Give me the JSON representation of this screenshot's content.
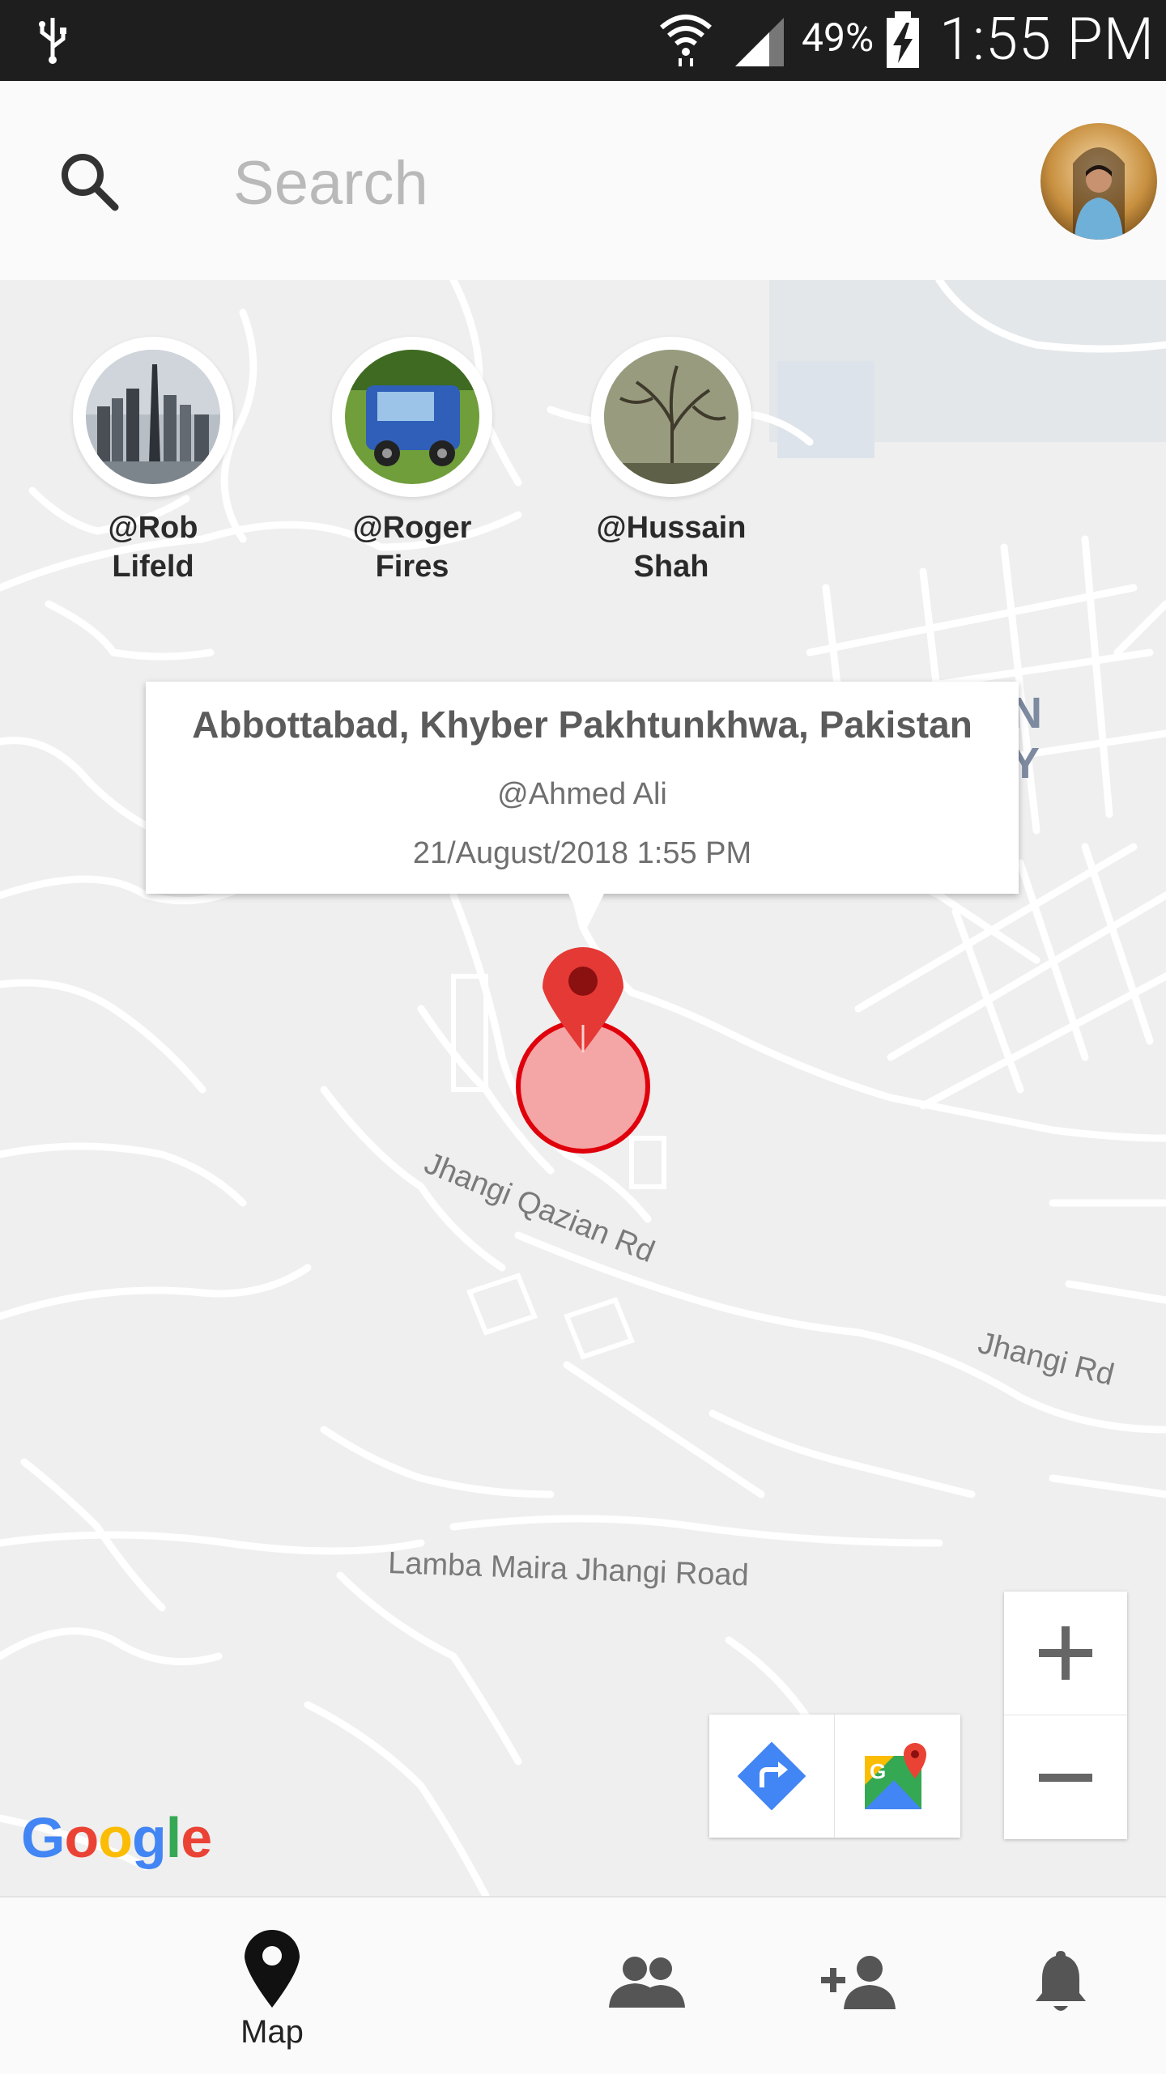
{
  "status_bar": {
    "battery": "49%",
    "time": "1:55 PM"
  },
  "search": {
    "placeholder": "Search"
  },
  "friends": [
    {
      "handle": "@Rob Lifeld"
    },
    {
      "handle": "@Roger Fires"
    },
    {
      "handle": "@Hussain Shah"
    }
  ],
  "info_window": {
    "place": "Abbottabad, Khyber Pakhtunkhwa, Pakistan",
    "user": "@Ahmed Ali",
    "timestamp": "21/August/2018  1:55 PM"
  },
  "map": {
    "road_labels": [
      "Jhangi Qazian Rd",
      "Jhangi Rd",
      "Lamba Maira Jhangi Road"
    ],
    "partial_area_label": [
      "N",
      "Y"
    ],
    "logo": "Google"
  },
  "zoom": {
    "in": "+",
    "out": "−"
  },
  "bottom_nav": {
    "map_label": "Map",
    "active": "map"
  },
  "colors": {
    "marker": "#e53935",
    "accuracy_circle": "#f4a5a5",
    "accuracy_stroke": "#e0000c",
    "directions": "#4285f4"
  }
}
